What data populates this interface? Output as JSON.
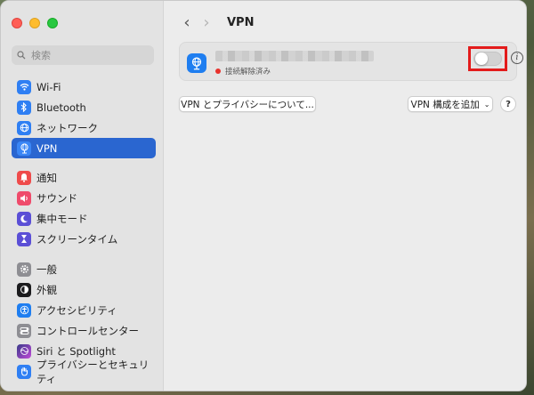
{
  "sidebar": {
    "search_placeholder": "検索",
    "items": [
      {
        "label": "Wi-Fi",
        "icon": "wifi-icon",
        "color": "#2f7ff3"
      },
      {
        "label": "Bluetooth",
        "icon": "bluetooth-icon",
        "color": "#2f7ff3"
      },
      {
        "label": "ネットワーク",
        "icon": "globe-icon",
        "color": "#2f7ff3"
      },
      {
        "label": "VPN",
        "icon": "vpn-globe-icon",
        "color": "#2f7ff3",
        "active": true
      },
      {
        "label": "通知",
        "icon": "bell-icon",
        "color": "#ef4b4b"
      },
      {
        "label": "サウンド",
        "icon": "speaker-icon",
        "color": "#ef4b6b"
      },
      {
        "label": "集中モード",
        "icon": "moon-icon",
        "color": "#5b4fd6"
      },
      {
        "label": "スクリーンタイム",
        "icon": "hourglass-icon",
        "color": "#5b4fd6"
      },
      {
        "label": "一般",
        "icon": "gear-icon",
        "color": "#8e8e93"
      },
      {
        "label": "外観",
        "icon": "appearance-icon",
        "color": "#1c1c1e"
      },
      {
        "label": "アクセシビリティ",
        "icon": "accessibility-icon",
        "color": "#1f7ef0"
      },
      {
        "label": "コントロールセンター",
        "icon": "control-center-icon",
        "color": "#8e8e93"
      },
      {
        "label": "Siri と Spotlight",
        "icon": "siri-icon",
        "color": "#9b4de0"
      },
      {
        "label": "プライバシーとセキュリティ",
        "icon": "hand-icon",
        "color": "#2f7ff3"
      }
    ]
  },
  "header": {
    "title": "VPN"
  },
  "vpn_card": {
    "status": "接続解除済み",
    "status_color": "#e8322c",
    "toggle_on": false,
    "highlight_color": "#e31b1b"
  },
  "buttons": {
    "privacy": "VPN とプライバシーについて...",
    "add_config": "VPN 構成を追加",
    "help": "?"
  },
  "accent": "#2a66d0"
}
